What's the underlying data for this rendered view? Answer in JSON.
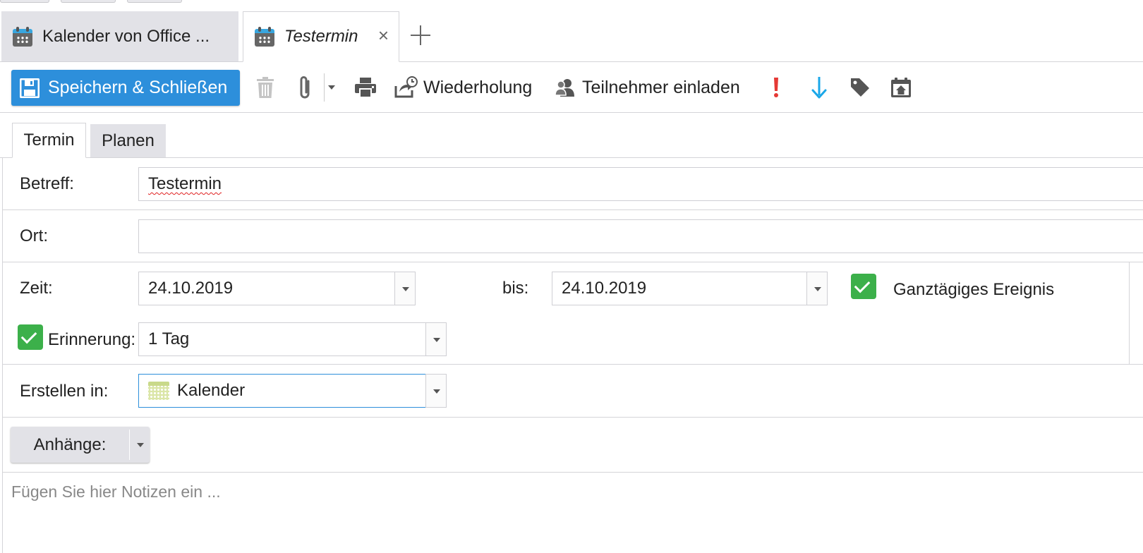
{
  "tabs": {
    "inactive_title": "Kalender von Office ...",
    "active_title": "Testermin",
    "close_glyph": "×"
  },
  "toolbar": {
    "save_label": "Speichern & Schließen",
    "recurrence_label": "Wiederholung",
    "invite_label": "Teilnehmer einladen",
    "icons": [
      "floppy-icon",
      "trash-icon",
      "paperclip-icon",
      "chevron-down-icon",
      "printer-icon",
      "recurrence-icon",
      "people-icon",
      "exclamation-icon",
      "arrow-down-icon",
      "tag-icon",
      "calendar-home-icon"
    ],
    "colors": {
      "save_bg": "#2d8fdb",
      "high_priority": "#e53935",
      "low_priority": "#1aa7e8"
    }
  },
  "form_tabs": {
    "event": "Termin",
    "schedule": "Planen"
  },
  "form": {
    "subject_label": "Betreff:",
    "subject_value": "Testermin",
    "location_label": "Ort:",
    "location_value": "",
    "time_label": "Zeit:",
    "start_date": "24.10.2019",
    "until_label": "bis:",
    "end_date": "24.10.2019",
    "all_day_label": "Ganztägiges Ereignis",
    "all_day_checked": true,
    "reminder_label": "Erinnerung:",
    "reminder_checked": true,
    "reminder_value": "1 Tag",
    "create_in_label": "Erstellen in:",
    "create_in_value": "Kalender",
    "attachments_label": "Anhänge:",
    "notes_placeholder": "Fügen Sie hier Notizen ein ..."
  }
}
